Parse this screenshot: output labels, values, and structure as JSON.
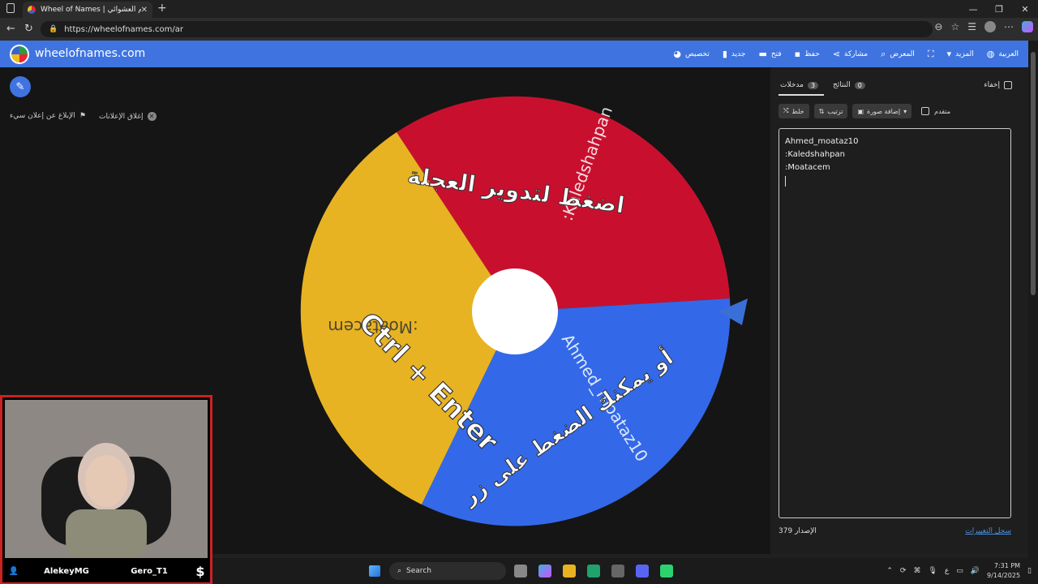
{
  "browser": {
    "tab_title": "Wheel of Names | الاسم العشوائي",
    "url": "https://wheelofnames.com/ar"
  },
  "app": {
    "logo_text": "wheelofnames.com",
    "menu": [
      {
        "label": "تخصيص",
        "icon": "palette-icon"
      },
      {
        "label": "جديد",
        "icon": "file-icon"
      },
      {
        "label": "فتح",
        "icon": "folder-icon"
      },
      {
        "label": "حفظ",
        "icon": "save-icon"
      },
      {
        "label": "مشاركة",
        "icon": "share-icon"
      },
      {
        "label": "المعرض",
        "icon": "search-icon"
      },
      {
        "label": "",
        "icon": "fullscreen-icon"
      },
      {
        "label": "المزيد",
        "icon": "chevron-down-icon"
      },
      {
        "label": "العربية",
        "icon": "globe-icon"
      }
    ]
  },
  "ads": {
    "close_ads": "إغلاق الإعلانات",
    "report_ad": "الإبلاغ عن إعلان سيء"
  },
  "wheel": {
    "center_text_line1": "اضغط لتدوير العجلة",
    "center_text_line2": "أو يمكنك الضغط على زر",
    "shortcut": "Ctrl + Enter",
    "segments": [
      {
        "label": ":Kaledshahpan",
        "color": "#c8102e"
      },
      {
        "label": "Ahmed_moataz10",
        "color": "#3369e8"
      },
      {
        "label": ":Moatacem",
        "color": "#e8b322"
      }
    ]
  },
  "panel": {
    "entries_tab": "مدخلات",
    "entries_count": "3",
    "results_tab": "النتائج",
    "results_count": "0",
    "hide_label": "إخفاء",
    "shuffle": "خلط",
    "sort": "ترتيب",
    "add_image": "إضافة صورة",
    "advanced": "متقدم",
    "entries": [
      "Ahmed_moataz10",
      ":Kaledshahpan",
      ":Moatacem"
    ],
    "version": "الإصدار 379",
    "changelog": "سجل التغييرات"
  },
  "webcam": {
    "name_left": "AlekeyMG",
    "name_right": "Gero_T1"
  },
  "taskbar": {
    "search": "Search",
    "time": "7:31 PM",
    "date": "9/14/2025"
  }
}
